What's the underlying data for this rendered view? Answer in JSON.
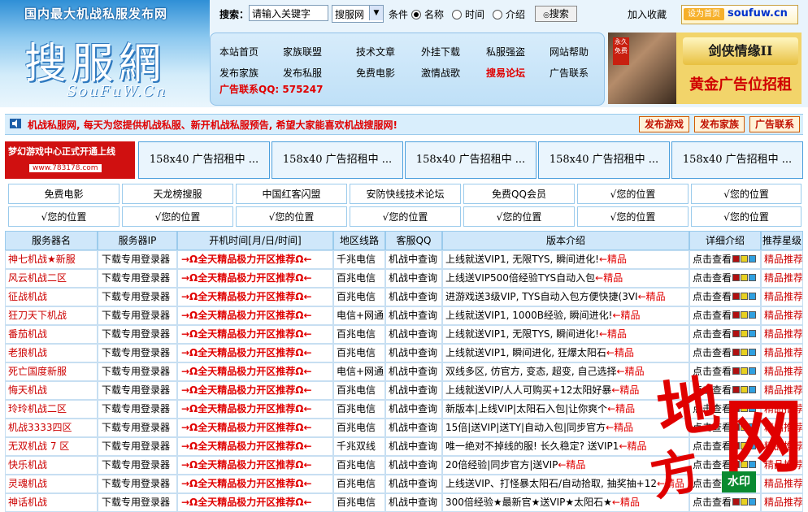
{
  "header": {
    "slogan": "国内最大机战私服发布网",
    "logo_text": "搜服網",
    "logo_sub": "SouFuW.Cn",
    "search_label": "搜索：",
    "search_placeholder": "请输入关键字",
    "search_select": "搜服网",
    "condition_label": "条件",
    "radio_options": [
      "名称",
      "时间",
      "介绍"
    ],
    "search_button": "搜索",
    "add_favorite": "加入收藏",
    "badge_tag": "设为首页",
    "domain": "soufuw.cn"
  },
  "nav": {
    "row1": [
      "本站首页",
      "家族联盟",
      "技术文章",
      "外挂下载",
      "私服强盗",
      "网站帮助"
    ],
    "row2": [
      "发布家族",
      "发布私服",
      "免费电影",
      "激情战歌",
      "搜易论坛",
      "广告联系"
    ],
    "ad_contact": "广告联系QQ: 575247"
  },
  "banner_ad": {
    "title": "剑侠情缘II",
    "tag": "永久免费",
    "text": "黄金广告位招租"
  },
  "notice": {
    "text": "机战私服网, 每天为您提供机战私服、新开机战私服预告, 希望大家能喜欢机战搜服网!",
    "buttons": [
      "发布游戏",
      "发布家族",
      "广告联系"
    ]
  },
  "banners": {
    "first_line1": "梦幻游戏中心正式开通上线",
    "first_line2": "www.783178.com",
    "cells": [
      "158x40 广告招租中 ...",
      "158x40 广告招租中 ...",
      "158x40 广告招租中 ...",
      "158x40 广告招租中 ...",
      "158x40 广告招租中 ..."
    ]
  },
  "links": {
    "row1": [
      "免费电影",
      "天龙榜搜服",
      "中国红客闪盟",
      "安防快线技术论坛",
      "免费QQ会员",
      "√您的位置",
      "√您的位置"
    ],
    "row2": [
      "√您的位置",
      "√您的位置",
      "√您的位置",
      "√您的位置",
      "√您的位置",
      "√您的位置",
      "√您的位置"
    ]
  },
  "table": {
    "headers": [
      "服务器名",
      "服务器IP",
      "开机时间[月/日/时间]",
      "地区线路",
      "客服QQ",
      "版本介绍",
      "详细介绍",
      "推荐星级"
    ],
    "ip_text": "下载专用登录器",
    "time_text": "→Ω全天精品极力开区推荐Ω←",
    "qq_text": "机战中查询",
    "detail_text": "点击查看",
    "rec_text": "精品推荐",
    "tag_text": "←精品",
    "rows": [
      {
        "name": "神七机战★新服",
        "line": "千兆电信",
        "ver": "上线就送VIP1, 无限TYS, 瞬间进化!"
      },
      {
        "name": "风云机战二区",
        "line": "百兆电信",
        "ver": "上线送VIP500倍经验TYS自动入包"
      },
      {
        "name": "征战机战",
        "line": "百兆电信",
        "ver": "进游戏送3级VIP, TYS自动入包方便快捷(3VI"
      },
      {
        "name": "狂刀天下机战",
        "line": "电信+网通",
        "ver": "上线就送VIP1, 1000B经验, 瞬间进化!"
      },
      {
        "name": "番茄机战",
        "line": "百兆电信",
        "ver": "上线就送VIP1, 无限TYS, 瞬间进化!"
      },
      {
        "name": "老狼机战",
        "line": "百兆电信",
        "ver": "上线就送VIP1, 瞬间进化, 狂爆太阳石"
      },
      {
        "name": "死亡国度新服",
        "line": "电信+网通",
        "ver": "双线多区, 仿官方, 变态, 超变, 自己选择"
      },
      {
        "name": "悔天机战",
        "line": "百兆电信",
        "ver": "上线就送VIP/人人可购买+12太阳好暴"
      },
      {
        "name": "玲玲机战二区",
        "line": "百兆电信",
        "ver": "新版本|上线VIP|太阳石入包|让你爽个"
      },
      {
        "name": "机战3333四区",
        "line": "百兆电信",
        "ver": "15倍|送VIP|送TY|自动入包|同步官方"
      },
      {
        "name": "无双机战 7 区",
        "line": "千兆双线",
        "ver": "唯一绝对不掉线的服! 长久稳定? 送VIP1"
      },
      {
        "name": "快乐机战",
        "line": "百兆电信",
        "ver": "20倍经验|同步官方|送VIP"
      },
      {
        "name": "灵魂机战",
        "line": "百兆电信",
        "ver": "上线送VIP、打怪暴太阳石/自动拾取, 抽奖抽+12"
      },
      {
        "name": "神话机战",
        "line": "百兆电信",
        "ver": "300倍经验★最新官★送VIP★太阳石★"
      }
    ]
  },
  "watermark": {
    "char1": "地",
    "char2": "方",
    "char3": "网",
    "stamp": "水印"
  },
  "colors": {
    "accent_blue": "#2f8fd6",
    "alert_red": "#e00000",
    "header_bg": "#cfe7fa"
  }
}
